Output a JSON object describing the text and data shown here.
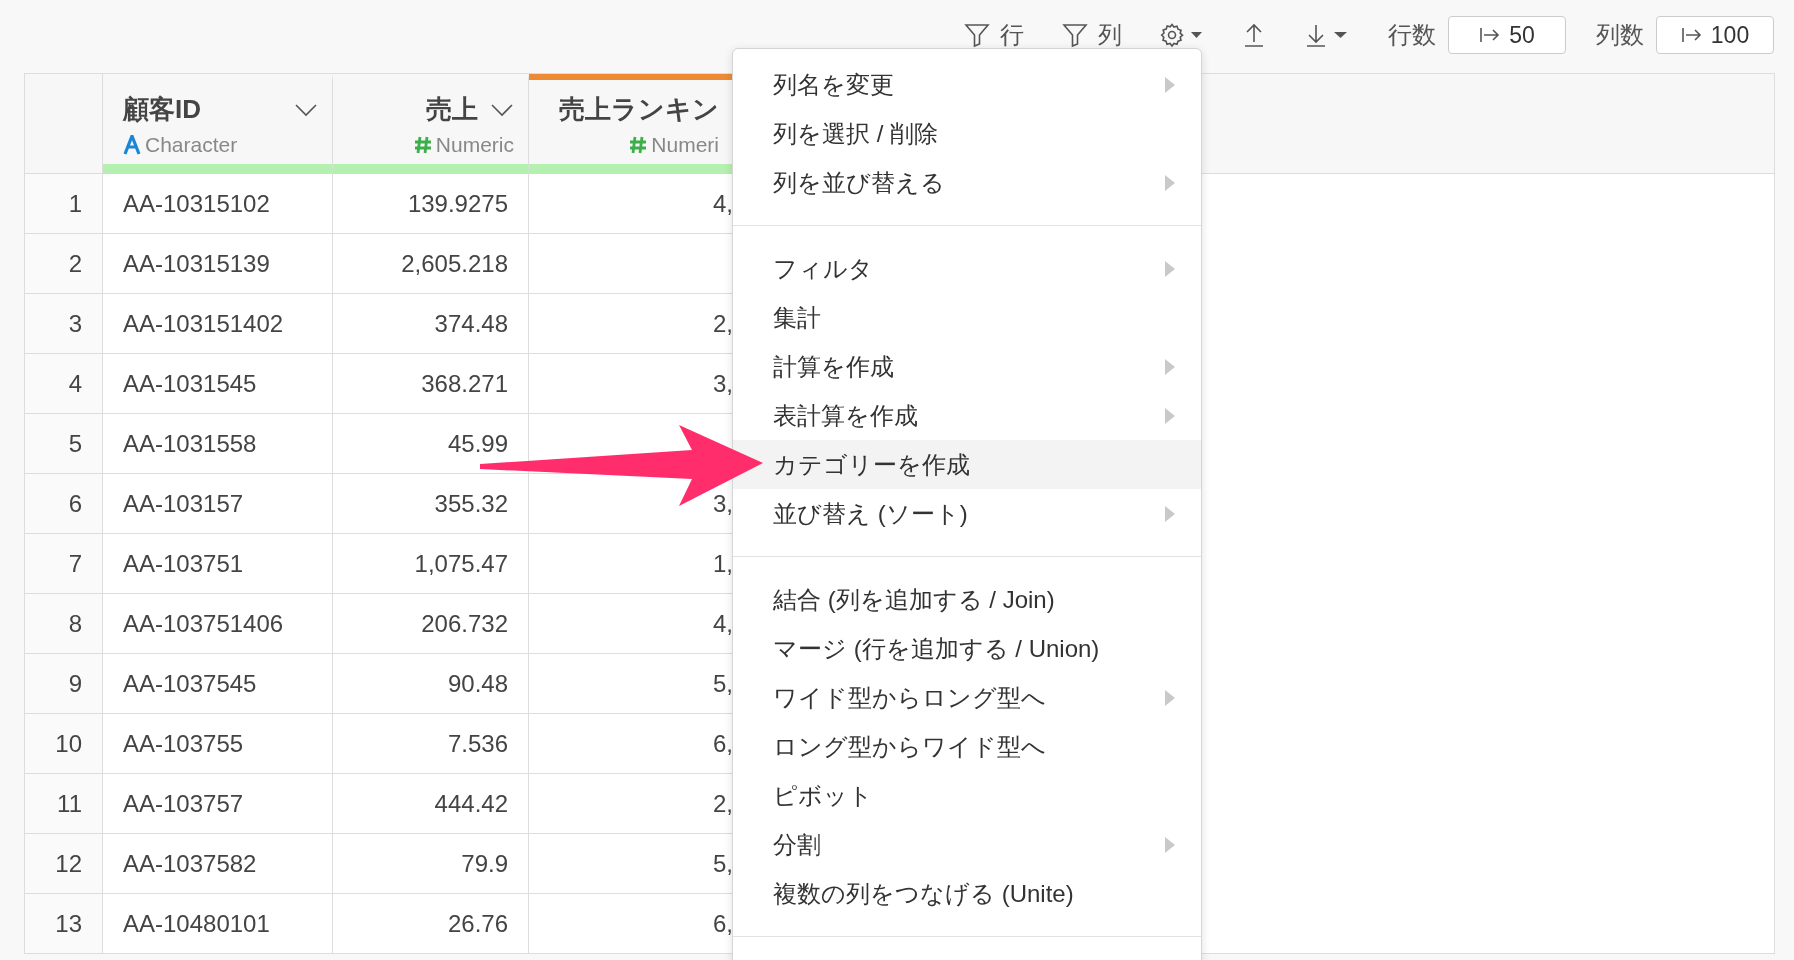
{
  "toolbar": {
    "actions": [
      {
        "kind": "filter",
        "label": "行"
      },
      {
        "kind": "filter",
        "label": "列"
      },
      {
        "kind": "settings"
      },
      {
        "kind": "upload"
      },
      {
        "kind": "download"
      }
    ],
    "limits": [
      {
        "label": "行数",
        "value": "50"
      },
      {
        "label": "列数",
        "value": "100"
      }
    ]
  },
  "table": {
    "columns": [
      {
        "name": "顧客ID",
        "type": "Character",
        "kind": "character",
        "dropdown": true,
        "selected": false
      },
      {
        "name": "売上",
        "type": "Numeric",
        "kind": "numeric",
        "dropdown": true,
        "selected": false
      },
      {
        "name": "売上ランキン",
        "type": "Numeri",
        "kind": "numeric",
        "dropdown": false,
        "selected": true
      }
    ],
    "rows": [
      {
        "number": "1",
        "cells": [
          "AA-10315102",
          "139.9275",
          "4,"
        ]
      },
      {
        "number": "2",
        "cells": [
          "AA-10315139",
          "2,605.218"
        ]
      },
      {
        "number": "3",
        "cells": [
          "AA-103151402",
          "374.48",
          "2,"
        ]
      },
      {
        "number": "4",
        "cells": [
          "AA-1031545",
          "368.271",
          "3,"
        ]
      },
      {
        "number": "5",
        "cells": [
          "AA-1031558",
          "45.99"
        ]
      },
      {
        "number": "6",
        "cells": [
          "AA-103157",
          "355.32",
          "3,"
        ]
      },
      {
        "number": "7",
        "cells": [
          "AA-103751",
          "1,075.47",
          "1,"
        ]
      },
      {
        "number": "8",
        "cells": [
          "AA-103751406",
          "206.732",
          "4,"
        ]
      },
      {
        "number": "9",
        "cells": [
          "AA-1037545",
          "90.48",
          "5,"
        ]
      },
      {
        "number": "10",
        "cells": [
          "AA-103755",
          "7.536",
          "6,"
        ]
      },
      {
        "number": "11",
        "cells": [
          "AA-103757",
          "444.42",
          "2,"
        ]
      },
      {
        "number": "12",
        "cells": [
          "AA-1037582",
          "79.9",
          "5,"
        ]
      },
      {
        "number": "13",
        "cells": [
          "AA-10480101",
          "26.76",
          "6,"
        ]
      }
    ]
  },
  "context_menu": {
    "groups": [
      [
        {
          "label": "列名を変更",
          "submenu": true,
          "selected": false
        },
        {
          "label": "列を選択 / 削除",
          "submenu": false,
          "selected": false
        },
        {
          "label": "列を並び替える",
          "submenu": true,
          "selected": false
        }
      ],
      [
        {
          "label": "フィルタ",
          "submenu": true,
          "selected": false
        },
        {
          "label": "集計",
          "submenu": false,
          "selected": false
        },
        {
          "label": "計算を作成",
          "submenu": true,
          "selected": false
        },
        {
          "label": "表計算を作成",
          "submenu": true,
          "selected": false
        },
        {
          "label": "カテゴリーを作成",
          "submenu": false,
          "selected": true
        },
        {
          "label": "並び替え (ソート)",
          "submenu": true,
          "selected": false
        }
      ],
      [
        {
          "label": "結合 (列を追加する / Join)",
          "submenu": false,
          "selected": false
        },
        {
          "label": "マージ (行を追加する / Union)",
          "submenu": false,
          "selected": false
        },
        {
          "label": "ワイド型からロング型へ",
          "submenu": true,
          "selected": false
        },
        {
          "label": "ロング型からワイド型へ",
          "submenu": false,
          "selected": false
        },
        {
          "label": "ピボット",
          "submenu": false,
          "selected": false
        },
        {
          "label": "分割",
          "submenu": true,
          "selected": false
        },
        {
          "label": "複数の列をつなげる (Unite)",
          "submenu": false,
          "selected": false
        }
      ]
    ]
  }
}
